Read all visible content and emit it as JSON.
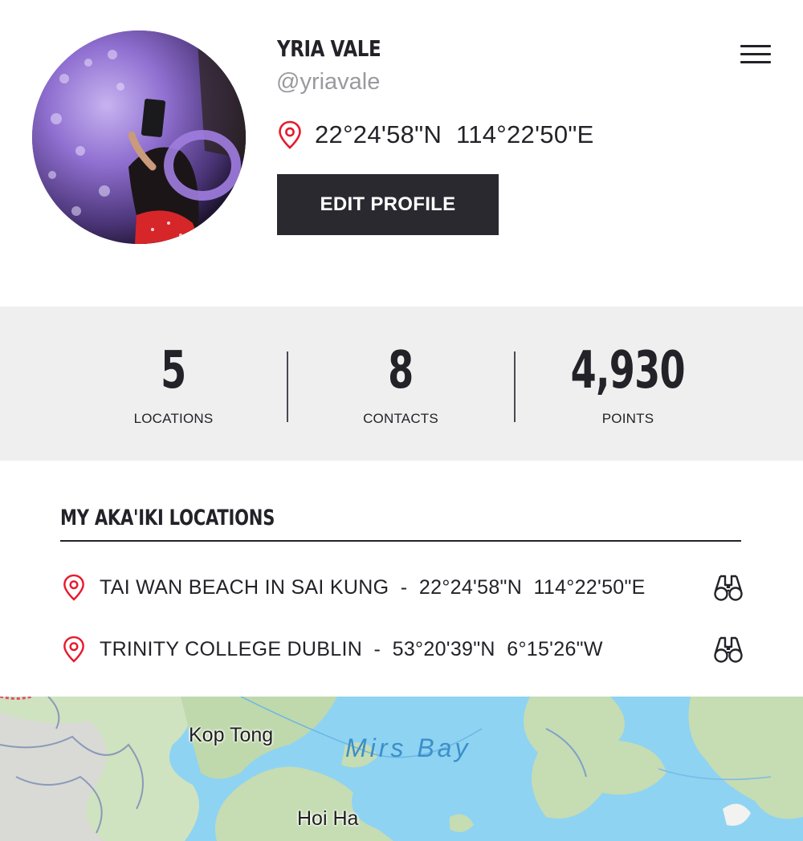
{
  "profile": {
    "name": "YRIA VALE",
    "handle": "@yriavale",
    "coordinates": "22°24'58\"N  114°22'50\"E",
    "edit_label": "EDIT PROFILE"
  },
  "stats": [
    {
      "value": "5",
      "label": "LOCATIONS"
    },
    {
      "value": "8",
      "label": "CONTACTS"
    },
    {
      "value": "4,930",
      "label": "POINTS"
    }
  ],
  "locations_section": {
    "title": "MY AKA'IKI LOCATIONS",
    "items": [
      {
        "text": "TAI WAN BEACH IN SAI KUNG  -  22°24'58\"N  114°22'50\"E"
      },
      {
        "text": "TRINITY COLLEGE DUBLIN  -  53°20'39\"N  6°15'26\"W"
      }
    ]
  },
  "map": {
    "labels": [
      "Kop Tong",
      "Hoi Ha"
    ],
    "water_label": "Mirs Bay"
  },
  "colors": {
    "accent_red": "#e8192c",
    "dark": "#2a2930",
    "stats_bg": "#efefef",
    "water": "#8ed3f2",
    "land": "#cfe3c0"
  },
  "icons": [
    "location-pin-icon",
    "hamburger-menu-icon",
    "binoculars-icon"
  ]
}
